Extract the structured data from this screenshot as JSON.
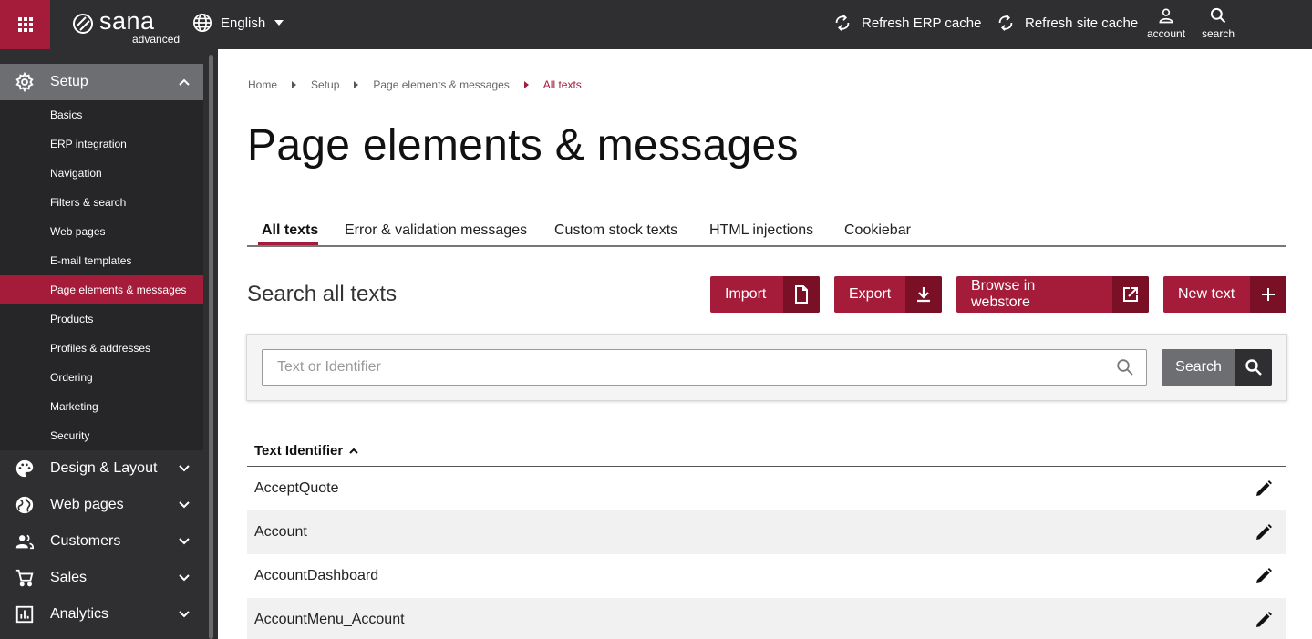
{
  "topbar": {
    "logo_name": "sana",
    "logo_sub": "advanced",
    "language": "English",
    "refresh_erp": "Refresh ERP cache",
    "refresh_site": "Refresh site cache",
    "account": "account",
    "search": "search"
  },
  "sidebar": {
    "sections": [
      {
        "label": "Setup",
        "icon": "gear-icon",
        "expanded": true
      },
      {
        "label": "Design & Layout",
        "icon": "palette-icon"
      },
      {
        "label": "Web pages",
        "icon": "globe-icon"
      },
      {
        "label": "Customers",
        "icon": "people-icon"
      },
      {
        "label": "Sales",
        "icon": "cart-icon"
      },
      {
        "label": "Analytics",
        "icon": "chart-icon"
      }
    ],
    "setup_items": [
      "Basics",
      "ERP integration",
      "Navigation",
      "Filters & search",
      "Web pages",
      "E-mail templates",
      "Page elements & messages",
      "Products",
      "Profiles & addresses",
      "Ordering",
      "Marketing",
      "Security"
    ],
    "active_item": "Page elements & messages"
  },
  "breadcrumb": [
    "Home",
    "Setup",
    "Page elements & messages",
    "All texts"
  ],
  "page_title": "Page elements & messages",
  "tabs": [
    "All texts",
    "Error & validation messages",
    "Custom stock texts",
    "HTML injections",
    "Cookiebar"
  ],
  "search_heading": "Search all texts",
  "buttons": {
    "import": "Import",
    "export": "Export",
    "browse": "Browse in webstore",
    "new_text": "New text"
  },
  "search": {
    "placeholder": "Text or Identifier",
    "button": "Search"
  },
  "table": {
    "header": "Text Identifier",
    "rows": [
      "AcceptQuote",
      "Account",
      "AccountDashboard",
      "AccountMenu_Account"
    ]
  },
  "colors": {
    "accent": "#a51c3a",
    "accent_dark": "#7a1026",
    "sidebar_bg": "#2f2f31"
  }
}
